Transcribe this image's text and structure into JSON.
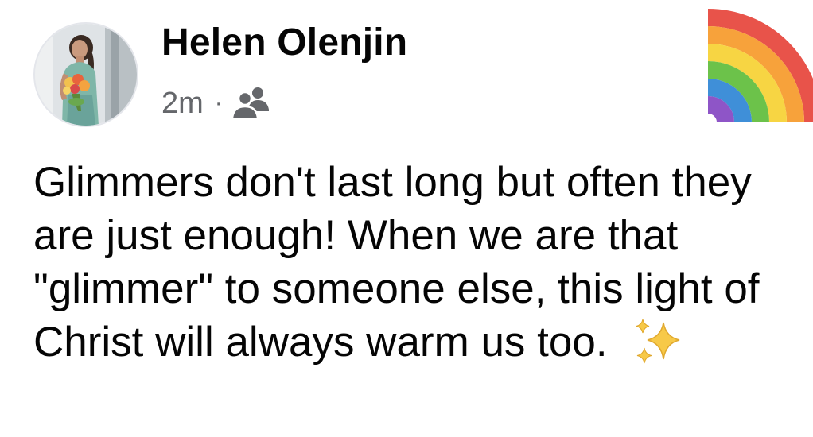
{
  "post": {
    "author_name": "Helen Olenjin",
    "timestamp": "2m",
    "separator": "·",
    "audience_icon": "friends-icon",
    "avatar_icon": "profile-photo",
    "decoration_icon": "rainbow-emoji",
    "body_text": "Glimmers don't last long but often they are just enough! When we are that \"glimmer\" to someone else, this light of Christ will always warm us too.",
    "trailing_emoji": "sparkles-emoji"
  },
  "colors": {
    "text_primary": "#050505",
    "text_secondary": "#65676b",
    "background": "#ffffff"
  }
}
